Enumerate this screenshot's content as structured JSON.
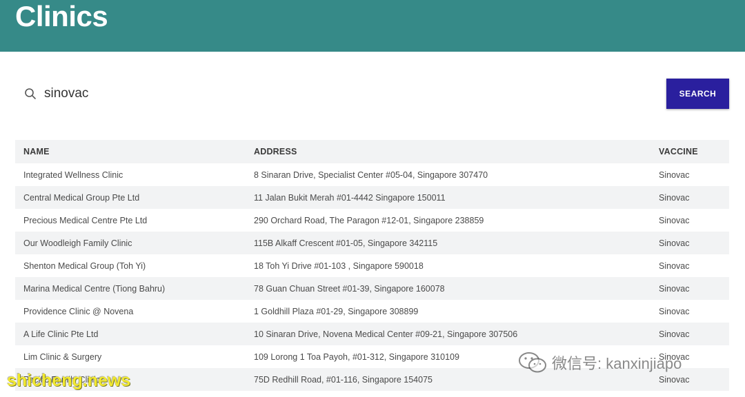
{
  "header": {
    "title": "Clinics"
  },
  "search": {
    "value": "sinovac",
    "button_label": "SEARCH"
  },
  "table": {
    "columns": [
      "NAME",
      "ADDRESS",
      "VACCINE"
    ],
    "rows": [
      [
        "Integrated Wellness Clinic",
        "8 Sinaran Drive, Specialist Center #05-04, Singapore 307470",
        "Sinovac"
      ],
      [
        "Central Medical Group Pte Ltd",
        "11 Jalan Bukit Merah #01-4442 Singapore 150011",
        "Sinovac"
      ],
      [
        "Precious Medical Centre Pte Ltd",
        "290 Orchard Road, The Paragon #12-01, Singapore 238859",
        "Sinovac"
      ],
      [
        "Our Woodleigh Family Clinic",
        "115B Alkaff Crescent #01-05, Singapore 342115",
        "Sinovac"
      ],
      [
        "Shenton Medical Group (Toh Yi)",
        "18 Toh Yi Drive #01-103 , Singapore 590018",
        "Sinovac"
      ],
      [
        "Marina Medical Centre (Tiong Bahru)",
        "78 Guan Chuan Street #01-39, Singapore 160078",
        "Sinovac"
      ],
      [
        "Providence Clinic @ Novena",
        "1 Goldhill Plaza #01-29, Singapore 308899",
        "Sinovac"
      ],
      [
        "A Life Clinic Pte Ltd",
        "10 Sinaran Drive, Novena Medical Center #09-21, Singapore 307506",
        "Sinovac"
      ],
      [
        "Lim Clinic & Surgery",
        "109 Lorong 1 Toa Payoh, #01-312, Singapore 310109",
        "Sinovac"
      ],
      [
        "Pacific Family Clinic",
        "75D Redhill Road, #01-116, Singapore 154075",
        "Sinovac"
      ]
    ]
  },
  "watermarks": {
    "wechat_text": "微信号: kanxinjiapo",
    "site_text": "shicheng.news"
  },
  "colors": {
    "header_bg": "#368a88",
    "button_bg": "#2a1f9e",
    "row_stripe": "#f2f3f4"
  }
}
